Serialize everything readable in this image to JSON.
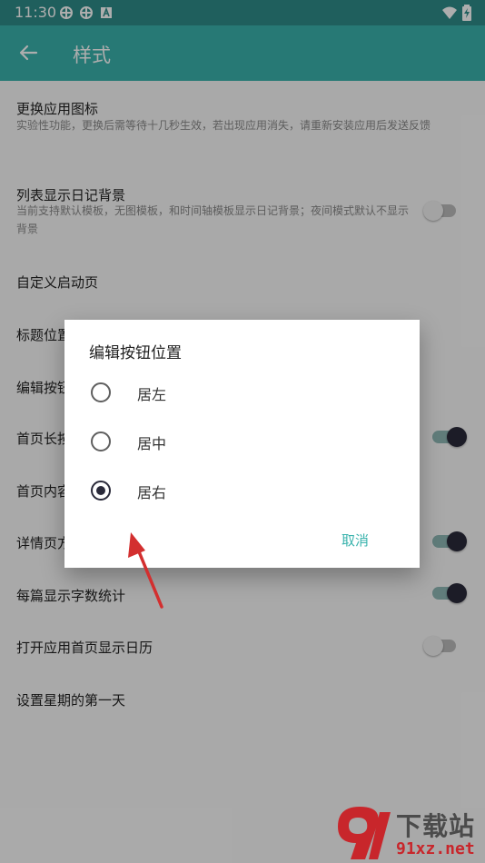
{
  "status_bar": {
    "time": "11:30"
  },
  "app_bar": {
    "title": "样式"
  },
  "settings": [
    {
      "title": "更换应用图标",
      "subtitle": "实验性功能，更换后需等待十几秒生效，若出现应用消失，请重新安装应用后发送反馈"
    },
    {
      "title": "列表显示日记背景",
      "subtitle": "当前支持默认模板，无图模板，和时间轴模板显示日记背景；夜间模式默认不显示背景",
      "toggle_on": false
    },
    {
      "title": "自定义启动页"
    },
    {
      "title": "标题位置"
    },
    {
      "title": "编辑按钮"
    },
    {
      "title": "首页长按",
      "toggle_on": true
    },
    {
      "title": "首页内容"
    },
    {
      "title": "详情页方",
      "toggle_on": true
    },
    {
      "title": "每篇显示字数统计",
      "toggle_on": true
    },
    {
      "title": "打开应用首页显示日历",
      "toggle_on": false
    },
    {
      "title": "设置星期的第一天"
    }
  ],
  "dialog": {
    "title": "编辑按钮位置",
    "options": [
      {
        "label": "居左",
        "selected": false
      },
      {
        "label": "居中",
        "selected": false
      },
      {
        "label": "居右",
        "selected": true
      }
    ],
    "cancel_label": "取消"
  },
  "watermark": {
    "title": "下载站",
    "url": "91xz.net"
  },
  "colors": {
    "primary": "#3ab3ad",
    "status_bar": "#2f8c8a",
    "accent_dark": "#2a2a3a",
    "annotation_arrow": "#d32f2f"
  }
}
